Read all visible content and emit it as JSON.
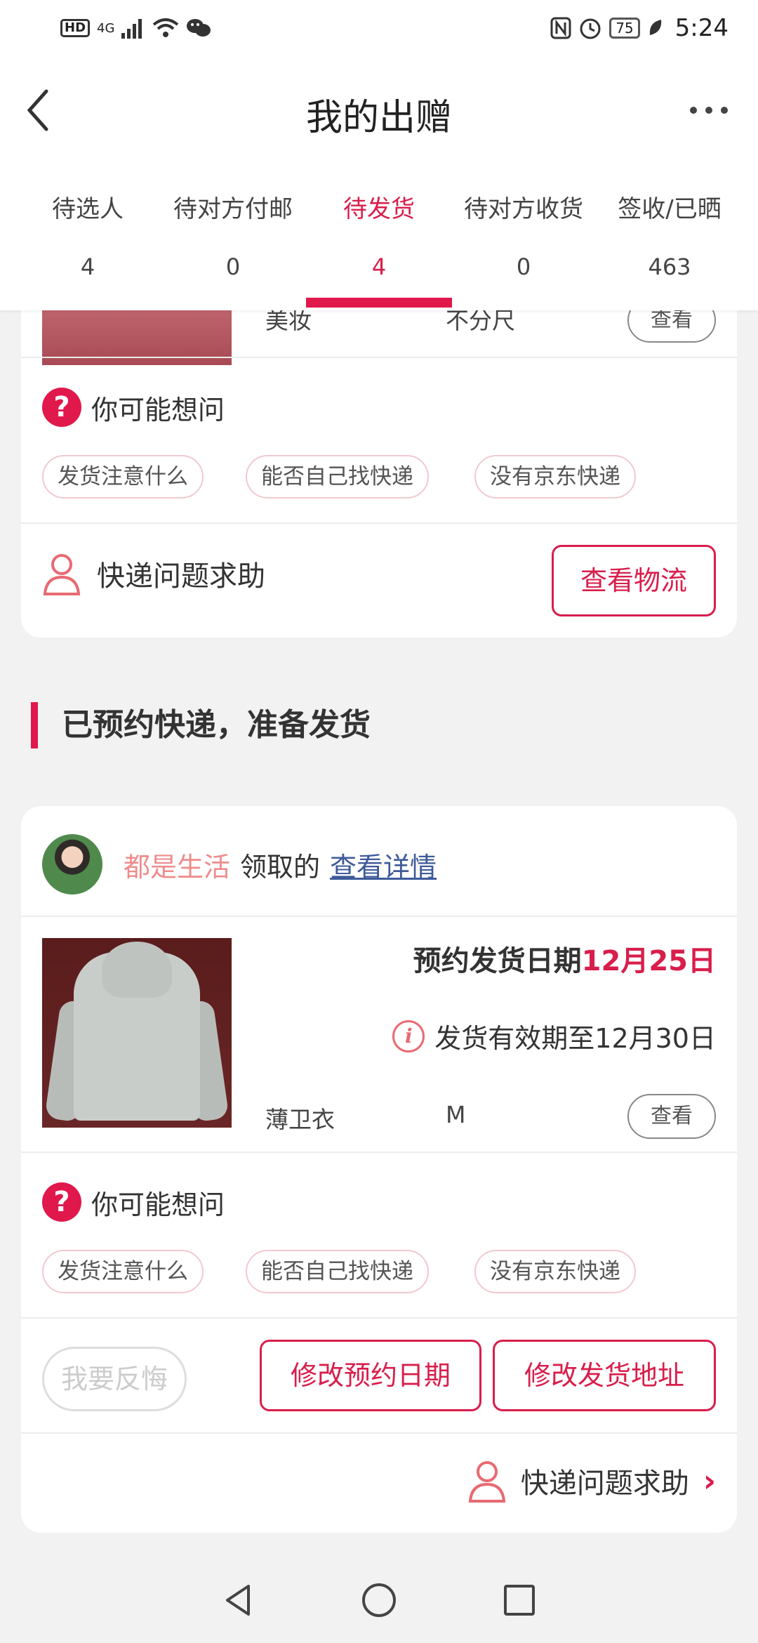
{
  "status_bar": {
    "hd": "HD",
    "network": "4G",
    "battery": "75",
    "time": "5:24"
  },
  "header": {
    "title": "我的出赠"
  },
  "tabs": [
    {
      "label": "待选人",
      "count": "4"
    },
    {
      "label": "待对方付邮",
      "count": "0"
    },
    {
      "label": "待发货",
      "count": "4"
    },
    {
      "label": "待对方收货",
      "count": "0"
    },
    {
      "label": "签收/已晒",
      "count": "463"
    }
  ],
  "active_tab": "待发货",
  "card1": {
    "category": "美妆",
    "size": "不分尺",
    "view_label": "查看",
    "faq_title": "你可能想问",
    "chips": [
      "发货注意什么",
      "能否自己找快递",
      "没有京东快递"
    ],
    "help_label": "快递问题求助",
    "logistics_label": "查看物流"
  },
  "section": {
    "title": "已预约快递，准备发货"
  },
  "card2": {
    "claimer_name": "都是生活",
    "claimed_text": "领取的",
    "detail_link": "查看详情",
    "ship_date_label": "预约发货日期",
    "ship_date_value": "12月25日",
    "validity_text": "发货有效期至12月30日",
    "category": "薄卫衣",
    "size": "M",
    "view_label": "查看",
    "faq_title": "你可能想问",
    "chips": [
      "发货注意什么",
      "能否自己找快递",
      "没有京东快递"
    ],
    "regret_label": "我要反悔",
    "modify_date_label": "修改预约日期",
    "modify_address_label": "修改发货地址",
    "help_label": "快递问题求助"
  },
  "colors": {
    "accent": "#e0184b",
    "claimer_name": "#ee8c8c",
    "link": "#3e5a9a"
  }
}
